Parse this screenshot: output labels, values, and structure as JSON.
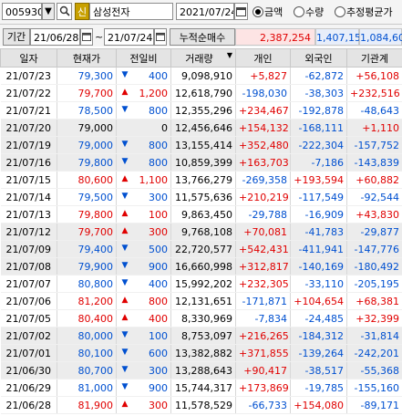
{
  "colors": {
    "up": "#e00000",
    "down": "#0050d0",
    "grid_alt": "#ececec",
    "header": "#e4e4e4"
  },
  "top": {
    "stock_code": "005930",
    "badge": "신",
    "stock_name": "삼성전자",
    "date": "2021/07/24",
    "radios": [
      {
        "label": "금액",
        "checked": true
      },
      {
        "label": "수량",
        "checked": false
      },
      {
        "label": "추정평균가",
        "checked": false
      }
    ]
  },
  "period": {
    "label": "기간",
    "from": "21/06/28",
    "tilde": "~",
    "to": "21/07/24",
    "sum_label": "누적순매수",
    "sum_individual": "2,387,254",
    "sum_foreign": "1,407,152",
    "sum_institution": "1,084,605"
  },
  "columns": [
    "일자",
    "현재가",
    "전일비",
    "거래량",
    "개인",
    "외국인",
    "기관계"
  ],
  "rows": [
    {
      "date": "21/07/23",
      "price": "79,300",
      "dir": "down",
      "chg": "400",
      "vol": "9,098,910",
      "ind": "+5,827",
      "frn": "-62,872",
      "inst": "+56,108"
    },
    {
      "date": "21/07/22",
      "price": "79,700",
      "dir": "up",
      "chg": "1,200",
      "vol": "12,618,790",
      "ind": "-198,030",
      "frn": "-38,303",
      "inst": "+232,516"
    },
    {
      "date": "21/07/21",
      "price": "78,500",
      "dir": "down",
      "chg": "800",
      "vol": "12,355,296",
      "ind": "+234,467",
      "frn": "-192,878",
      "inst": "-48,643"
    },
    {
      "date": "21/07/20",
      "price": "79,000",
      "dir": "none",
      "chg": "0",
      "vol": "12,456,646",
      "ind": "+154,132",
      "frn": "-168,111",
      "inst": "+1,110"
    },
    {
      "date": "21/07/19",
      "price": "79,000",
      "dir": "down",
      "chg": "800",
      "vol": "13,155,414",
      "ind": "+352,480",
      "frn": "-222,304",
      "inst": "-157,752"
    },
    {
      "date": "21/07/16",
      "price": "79,800",
      "dir": "down",
      "chg": "800",
      "vol": "10,859,399",
      "ind": "+163,703",
      "frn": "-7,186",
      "inst": "-143,839"
    },
    {
      "date": "21/07/15",
      "price": "80,600",
      "dir": "up",
      "chg": "1,100",
      "vol": "13,766,279",
      "ind": "-269,358",
      "frn": "+193,594",
      "inst": "+60,882"
    },
    {
      "date": "21/07/14",
      "price": "79,500",
      "dir": "down",
      "chg": "300",
      "vol": "11,575,636",
      "ind": "+210,219",
      "frn": "-117,549",
      "inst": "-92,544"
    },
    {
      "date": "21/07/13",
      "price": "79,800",
      "dir": "up",
      "chg": "100",
      "vol": "9,863,450",
      "ind": "-29,788",
      "frn": "-16,909",
      "inst": "+43,830"
    },
    {
      "date": "21/07/12",
      "price": "79,700",
      "dir": "up",
      "chg": "300",
      "vol": "9,768,108",
      "ind": "+70,081",
      "frn": "-41,783",
      "inst": "-29,877"
    },
    {
      "date": "21/07/09",
      "price": "79,400",
      "dir": "down",
      "chg": "500",
      "vol": "22,720,577",
      "ind": "+542,431",
      "frn": "-411,941",
      "inst": "-147,776"
    },
    {
      "date": "21/07/08",
      "price": "79,900",
      "dir": "down",
      "chg": "900",
      "vol": "16,660,998",
      "ind": "+312,817",
      "frn": "-140,169",
      "inst": "-180,492"
    },
    {
      "date": "21/07/07",
      "price": "80,800",
      "dir": "down",
      "chg": "400",
      "vol": "15,992,202",
      "ind": "+232,305",
      "frn": "-33,110",
      "inst": "-205,195"
    },
    {
      "date": "21/07/06",
      "price": "81,200",
      "dir": "up",
      "chg": "800",
      "vol": "12,131,651",
      "ind": "-171,871",
      "frn": "+104,654",
      "inst": "+68,381"
    },
    {
      "date": "21/07/05",
      "price": "80,400",
      "dir": "up",
      "chg": "400",
      "vol": "8,330,969",
      "ind": "-7,834",
      "frn": "-24,485",
      "inst": "+32,399"
    },
    {
      "date": "21/07/02",
      "price": "80,000",
      "dir": "down",
      "chg": "100",
      "vol": "8,753,097",
      "ind": "+216,265",
      "frn": "-184,312",
      "inst": "-31,814"
    },
    {
      "date": "21/07/01",
      "price": "80,100",
      "dir": "down",
      "chg": "600",
      "vol": "13,382,882",
      "ind": "+371,855",
      "frn": "-139,264",
      "inst": "-242,201"
    },
    {
      "date": "21/06/30",
      "price": "80,700",
      "dir": "down",
      "chg": "300",
      "vol": "13,288,643",
      "ind": "+90,417",
      "frn": "-38,517",
      "inst": "-55,368"
    },
    {
      "date": "21/06/29",
      "price": "81,000",
      "dir": "down",
      "chg": "900",
      "vol": "15,744,317",
      "ind": "+173,869",
      "frn": "-19,785",
      "inst": "-155,160"
    },
    {
      "date": "21/06/28",
      "price": "81,900",
      "dir": "up",
      "chg": "300",
      "vol": "11,578,529",
      "ind": "-66,733",
      "frn": "+154,080",
      "inst": "-89,171"
    }
  ]
}
